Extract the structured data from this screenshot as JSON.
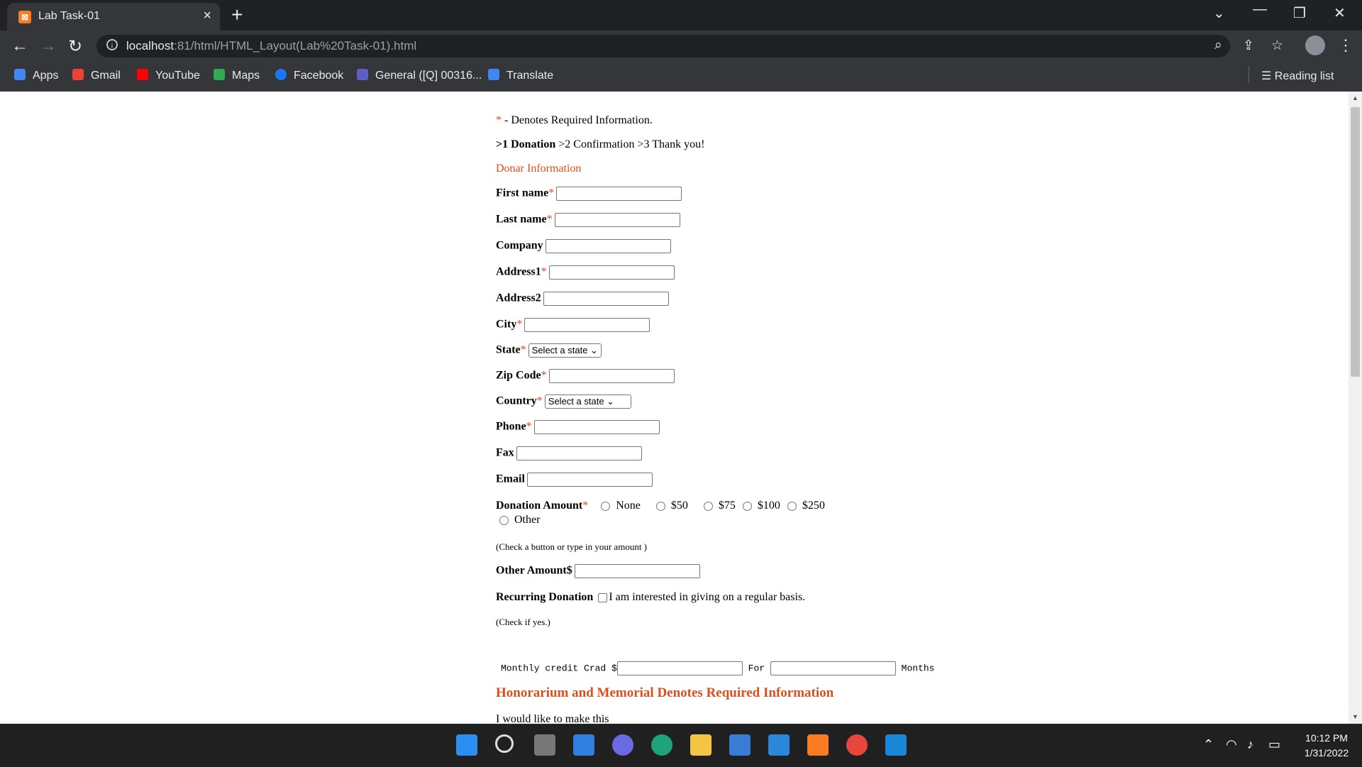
{
  "browser": {
    "tab_title": "Lab Task-01",
    "url_host": "localhost",
    "url_rest": ":81/html/HTML_Layout(Lab%20Task-01).html",
    "bookmarks": [
      {
        "label": "Apps",
        "icon": "apps-grid-icon",
        "color": "#4285f4"
      },
      {
        "label": "Gmail",
        "icon": "gmail-icon",
        "color": "#ea4335"
      },
      {
        "label": "YouTube",
        "icon": "youtube-icon",
        "color": "#ff0000"
      },
      {
        "label": "Maps",
        "icon": "maps-icon",
        "color": "#34a853"
      },
      {
        "label": "Facebook",
        "icon": "facebook-icon",
        "color": "#1877f2"
      },
      {
        "label": "General ([Q] 00316...",
        "icon": "teams-icon",
        "color": "#5b5fc7"
      },
      {
        "label": "Translate",
        "icon": "translate-icon",
        "color": "#4285f4"
      }
    ],
    "reading_list": "Reading list"
  },
  "form": {
    "required_note_star": "*",
    "required_note_text": " - Denotes Required Information.",
    "steps_bold": ">1 Donation",
    "steps_rest": " >2 Confirmation >3 Thank you!",
    "section_donor": "Donar Information",
    "required_star": "*",
    "fields": {
      "first_name": "First name",
      "last_name": "Last name",
      "company": "Company",
      "address1": "Address1",
      "address2": "Address2",
      "city": "City",
      "state": "State",
      "zip": "Zip Code",
      "country": "Country",
      "phone": "Phone",
      "fax": "Fax",
      "email": "Email"
    },
    "state_select_value": "Select a state",
    "country_select_value": "Select a state",
    "donation_label": "Donation Amount",
    "donation_options": [
      "None",
      "$50",
      "$75",
      "$100",
      "$250",
      "Other"
    ],
    "donation_hint": "(Check a button or type in your amount )",
    "other_amount_label": "Other Amount$",
    "recurring_label": "Recurring Donation",
    "recurring_text": "I am interested in giving on a regular basis.",
    "recurring_hint": "(Check if yes.)",
    "monthly_label": "Monthly credit Crad $",
    "for_label": "For",
    "months_label": "Months",
    "honorarium_heading": "Honorarium and Memorial Denotes Required Information",
    "make_this_text": "I would like to make this"
  },
  "taskbar": {
    "time": "10:12 PM",
    "date": "1/31/2022"
  }
}
